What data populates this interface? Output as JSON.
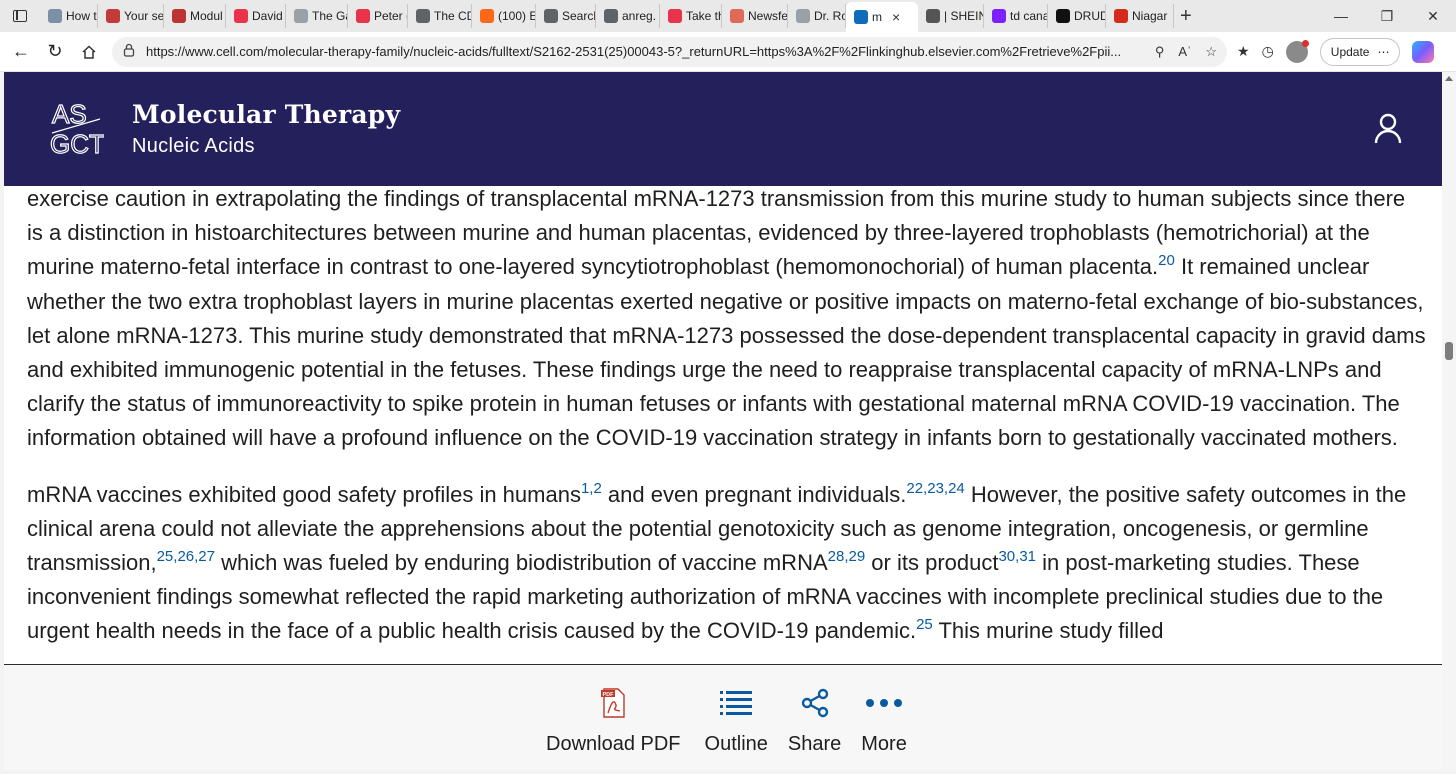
{
  "browser": {
    "tabs": [
      {
        "label": "How to",
        "icon": "generic-page-icon",
        "color": "#7b8fa6"
      },
      {
        "label": "Your se",
        "icon": "knife-icon",
        "color": "#c23a3a"
      },
      {
        "label": "Modul",
        "icon": "building-icon",
        "color": "#b33"
      },
      {
        "label": "David (",
        "icon": "youtube-icon",
        "color": "#e8334a"
      },
      {
        "label": "The Ga",
        "icon": "gp-icon",
        "color": "#9aa0a6"
      },
      {
        "label": "Peter (",
        "icon": "youtube-icon",
        "color": "#e8334a"
      },
      {
        "label": "The CD",
        "icon": "google-icon",
        "color": "#5f6368"
      },
      {
        "label": "(100) E",
        "icon": "substack-icon",
        "color": "#ff6719"
      },
      {
        "label": "Search",
        "icon": "search-icon",
        "color": "#5f6368"
      },
      {
        "label": "anreg.",
        "icon": "m-icon",
        "color": "#5f6368"
      },
      {
        "label": "Take th",
        "icon": "youtube-icon",
        "color": "#e8334a"
      },
      {
        "label": "Newsfe",
        "icon": "r-icon",
        "color": "#e06a5a"
      },
      {
        "label": "Dr. Rol",
        "icon": "gp-icon",
        "color": "#9aa0a6"
      },
      {
        "label": "m",
        "icon": "link-icon",
        "color": "#0f6cbd"
      },
      {
        "label": "| SHEIN",
        "icon": "s-icon",
        "color": "#555"
      },
      {
        "label": "td cana",
        "icon": "yahoo-icon",
        "color": "#7e1fff"
      },
      {
        "label": "DRUDG",
        "icon": "drudge-icon",
        "color": "#111"
      },
      {
        "label": "Niagar",
        "icon": "maple-leaf-icon",
        "color": "#d52b1e"
      }
    ],
    "active_tab_index": 13,
    "url": "https://www.cell.com/molecular-therapy-family/nucleic-acids/fulltext/S2162-2531(25)00043-5?_returnURL=https%3A%2F%2Flinkinghub.elsevier.com%2Fretrieve%2Fpii...",
    "update_label": "Update"
  },
  "header": {
    "journal_title": "Molecular Therapy",
    "journal_subtitle": "Nucleic Acids",
    "logo_text": "ASGCT",
    "bg_color": "#24205c"
  },
  "article": {
    "paragraph1": [
      {
        "t": "exercise caution in extrapolating the findings of transplacental mRNA-1273 transmission from this murine study to human subjects since there is a distinction in histoarchitectures between murine and human placentas, evidenced by three-layered trophoblasts (hemotrichorial) at the murine materno-fetal interface in contrast to one-layered syncytiotrophoblast (hemomonochorial) of human placenta."
      },
      {
        "sup": "20"
      },
      {
        "t": " It remained unclear whether the two extra trophoblast layers in murine placentas exerted negative or positive impacts on materno-fetal exchange of bio-substances, let alone mRNA-1273. This murine study demonstrated that mRNA-1273 possessed the dose-dependent transplacental capacity in gravid dams and exhibited immunogenic potential in the fetuses. These findings urge the need to reappraise transplacental capacity of mRNA-LNPs and clarify the status of immunoreactivity to spike protein in human fetuses or infants with gestational maternal mRNA COVID-19 vaccination. The information obtained will have a profound influence on the COVID-19 vaccination strategy in infants born to gestationally vaccinated mothers."
      }
    ],
    "paragraph2": [
      {
        "t": "mRNA vaccines exhibited good safety profiles in humans"
      },
      {
        "sup": "1,2"
      },
      {
        "t": " and even pregnant individuals."
      },
      {
        "sup": "22,23,24"
      },
      {
        "t": " However, the positive safety outcomes in the clinical arena could not alleviate the apprehensions about the potential genotoxicity such as genome integration, oncogenesis, or germline transmission,"
      },
      {
        "sup": "25,26,27"
      },
      {
        "t": " which was fueled by enduring biodistribution of vaccine mRNA"
      },
      {
        "sup": "28,29"
      },
      {
        "t": " or its product"
      },
      {
        "sup": "30,31"
      },
      {
        "t": " in post-marketing studies. These inconvenient findings somewhat reflected the rapid marketing authorization of mRNA vaccines with incomplete preclinical studies due to the urgent health needs in the face of a public health crisis caused by the COVID-19 pandemic."
      },
      {
        "sup": "25"
      },
      {
        "t": " This murine study filled"
      }
    ]
  },
  "bottom_actions": {
    "download_pdf": "Download PDF",
    "outline": "Outline",
    "share": "Share",
    "more": "More",
    "accent_color": "#0a5aa0"
  }
}
